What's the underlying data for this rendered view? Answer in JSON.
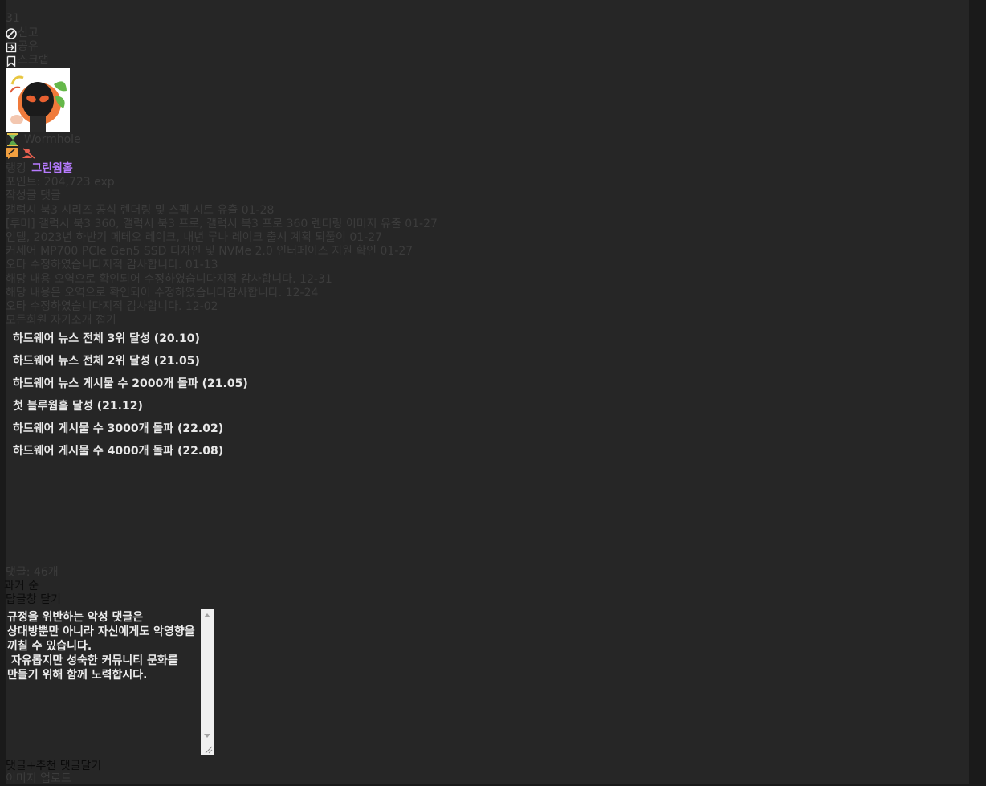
{
  "header": {
    "count": "31",
    "report": "신고",
    "share": "공유",
    "scrap": "스크랩"
  },
  "profile": {
    "nickname": "Wormhole",
    "rank_label": "랭킹",
    "rank_value": "그린웜홀",
    "points": "포인트: 204,723 exp"
  },
  "tabs": {
    "label": "작성글 댓글"
  },
  "posts": [
    {
      "title": "갤럭시 북3 시리즈 공식 렌더링 및 스펙 시트 유출",
      "date": "01-28"
    },
    {
      "title": "[루머] 갤럭시 북3 360, 갤럭시 북3 프로, 갤럭시 북3 프로 360 렌더링 이미지 유출",
      "date": "01-27"
    },
    {
      "title": "인텔, 2023년 하반기 메테오 레이크, 내년 루나 레이크 출시 계획 되풀이",
      "date": "01-27"
    },
    {
      "title": "커세어 MP700 PCIe Gen5 SSD 디자인 및 NVMe 2.0 인터페이스 지원 확인",
      "date": "01-27"
    }
  ],
  "comments": [
    {
      "text": "오타 수정하였습니다지적 감사합니다.",
      "date": "01-13"
    },
    {
      "text": "해당 내용 오역으로 확인되어 수정하였습니다지적 감사합니다.",
      "date": "12-31"
    },
    {
      "text": "해당 내용은 오역으로 확인되어 수정하였습니다감사합니다.",
      "date": "12-24"
    },
    {
      "text": "오타 수정하였습니다지적 감사합니다.",
      "date": "12-02"
    }
  ],
  "intro_toggle": "모든회원 자기소개 접기",
  "achievements": [
    "하드웨어 뉴스 전체 3위 달성 (20.10)",
    "하드웨어 뉴스 전체 2위 달성 (21.05)",
    "하드웨어 뉴스 게시물 수 2000개 돌파 (21.05)",
    "첫 블루웜홀 달성 (21.12)",
    "하드웨어 게시물 수 3000개 돌파 (22.02)",
    "하드웨어 게시물 수 4000개 돌파 (22.08)"
  ],
  "comments_section": {
    "count_label": "댓글: 46개",
    "sort_label": "과거 순",
    "close_reply": "답글창 닫기",
    "placeholder": "규정을 위반하는 악성 댓글은\n상대방뿐만 아니라 자신에게도 악영향을\n끼칠 수 있습니다.\n 자유롭지만 성숙한 커뮤니티 문화를\n만들기 위해 함께 노력합시다.",
    "submit_label": "댓글+추천 댓글달기",
    "image_upload": "이미지 업로드"
  },
  "colors": {
    "background": "#262626",
    "page_gutter": "#1a1a1a",
    "muted_text": "#3c3c3c",
    "rank_purple": "#b77bff",
    "achievement_text": "#e8e8e8"
  }
}
